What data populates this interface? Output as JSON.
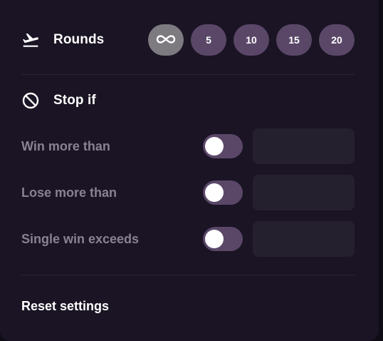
{
  "rounds": {
    "title": "Rounds",
    "icon": "airplane-takeoff-icon",
    "options": [
      "∞",
      "5",
      "10",
      "15",
      "20"
    ],
    "selected_index": 0
  },
  "stop_if": {
    "title": "Stop if",
    "icon": "prohibited-icon",
    "conditions": [
      {
        "label": "Win more than",
        "enabled": false,
        "value": ""
      },
      {
        "label": "Lose more than",
        "enabled": false,
        "value": ""
      },
      {
        "label": "Single win exceeds",
        "enabled": false,
        "value": ""
      }
    ]
  },
  "reset_label": "Reset settings",
  "colors": {
    "panel_bg": "#1a1424",
    "chip_bg": "#5a4768",
    "chip_selected_bg": "#7d7b80",
    "input_bg": "#25202e",
    "label_muted": "#8a8294"
  }
}
